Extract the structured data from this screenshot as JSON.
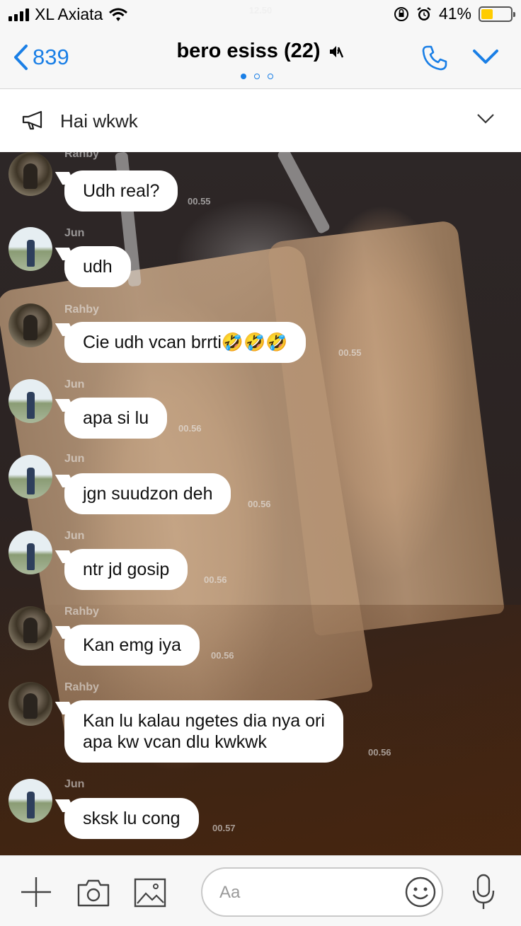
{
  "status_bar": {
    "carrier": "XL Axiata",
    "time": "12.50",
    "battery_text": "41%",
    "battery_level": 0.41
  },
  "nav": {
    "back_count": "839",
    "title": "bero esiss (22)",
    "page_index": 1,
    "page_count": 3
  },
  "announcement": {
    "text": "Hai wkwk"
  },
  "messages": [
    {
      "sender": "Rahby",
      "text": "Udh real?",
      "time": "00.55"
    },
    {
      "sender": "Jun",
      "text": "udh",
      "time": ""
    },
    {
      "sender": "Rahby",
      "text": "Cie udh vcan brrti🤣🤣🤣",
      "time": "00.55"
    },
    {
      "sender": "Jun",
      "text": "apa si lu",
      "time": "00.56"
    },
    {
      "sender": "Jun",
      "text": "jgn suudzon deh",
      "time": "00.56"
    },
    {
      "sender": "Jun",
      "text": "ntr jd gosip",
      "time": "00.56"
    },
    {
      "sender": "Rahby",
      "text": "Kan emg iya",
      "time": "00.56"
    },
    {
      "sender": "Rahby",
      "text": "Kan lu kalau ngetes dia nya ori\napa kw vcan dlu kwkwk",
      "time": "00.56"
    },
    {
      "sender": "Jun",
      "text": "sksk lu cong",
      "time": "00.57"
    }
  ],
  "input": {
    "placeholder": "Aa"
  },
  "colors": {
    "accent": "#1a7fe6",
    "battery": "#ffcc00"
  }
}
